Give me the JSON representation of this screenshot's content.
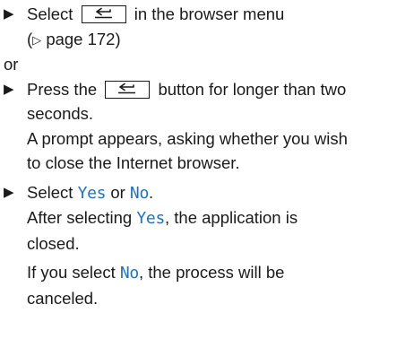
{
  "steps": [
    {
      "bullet": "▶",
      "pre": "Select",
      "key_icon": "back-key-icon",
      "post": "in the browser menu",
      "ref_open": "(",
      "ref_arrow": "▷",
      "ref_text": "page 172)"
    },
    {
      "bullet": "▶",
      "pre": "Press the",
      "key_icon": "back-key-icon",
      "post": "button for longer than two",
      "line2": "seconds.",
      "line3": "A prompt appears, asking whether you wish",
      "line4": "to close the Internet browser."
    },
    {
      "bullet": "▶",
      "pre": "Select",
      "yes": "Yes",
      "or": "or",
      "no": "No",
      "period": ".",
      "after_pre": "After selecting",
      "after_yes": "Yes",
      "after_post": ", the application is",
      "closed": "closed.",
      "if_pre": "If you select",
      "if_no": "No",
      "if_post": ", the process will be",
      "canceled": "canceled."
    }
  ],
  "or_text": "or"
}
